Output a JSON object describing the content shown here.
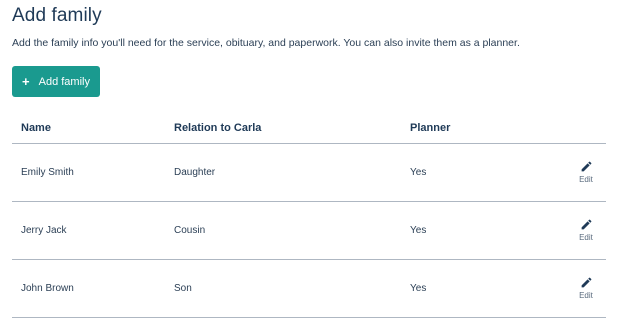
{
  "page": {
    "title": "Add family",
    "subtitle": "Add the family info you'll need for the service, obituary, and paperwork. You can also invite them as a planner.",
    "add_button_icon": "+",
    "add_button_label": "Add family"
  },
  "table": {
    "headers": [
      "Name",
      "Relation to Carla",
      "Planner"
    ],
    "rows": [
      {
        "name": "Emily Smith",
        "relation": "Daughter",
        "planner": "Yes",
        "edit_label": "Edit"
      },
      {
        "name": "Jerry Jack",
        "relation": "Cousin",
        "planner": "Yes",
        "edit_label": "Edit"
      },
      {
        "name": "John Brown",
        "relation": "Son",
        "planner": "Yes",
        "edit_label": "Edit"
      }
    ]
  },
  "colors": {
    "accent": "#1a9a8f",
    "text": "#1f3a57",
    "divider": "#aeb7c2",
    "edit_icon": "#1f3a57"
  },
  "icons": {
    "add": "plus-icon",
    "edit": "pencil-icon"
  }
}
